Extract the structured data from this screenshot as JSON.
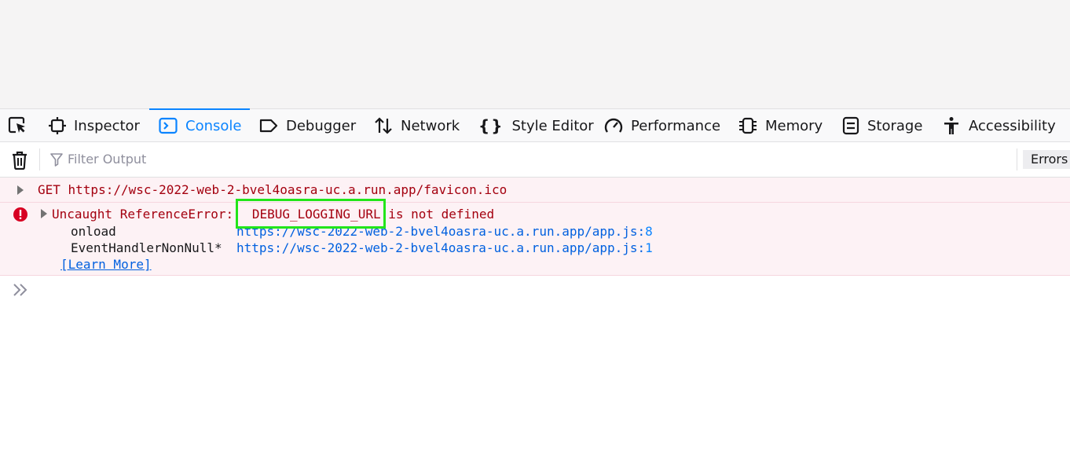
{
  "toolbar": {
    "tabs": [
      {
        "label": "Inspector",
        "icon": "inspector-icon"
      },
      {
        "label": "Console",
        "icon": "console-icon",
        "selected": true
      },
      {
        "label": "Debugger",
        "icon": "debugger-icon"
      },
      {
        "label": "Network",
        "icon": "network-icon"
      },
      {
        "label": "Style Editor",
        "icon": "style-editor-icon"
      },
      {
        "label": "Performance",
        "icon": "performance-icon"
      },
      {
        "label": "Memory",
        "icon": "memory-icon"
      },
      {
        "label": "Storage",
        "icon": "storage-icon"
      },
      {
        "label": "Accessibility",
        "icon": "accessibility-icon"
      }
    ]
  },
  "filterbar": {
    "placeholder": "Filter Output",
    "errors_label": "Errors"
  },
  "messages": {
    "get_request": {
      "text": "GET https://wsc-2022-web-2-bvel4oasra-uc.a.run.app/favicon.ico"
    },
    "error": {
      "prefix": "Uncaught ReferenceError: ",
      "name": "DEBUG_LOGGING_URL",
      "suffix": " is not defined",
      "stack": [
        {
          "fn": "onload",
          "url": "https://wsc-2022-web-2-bvel4oasra-uc.a.run.app/app.js:",
          "line": "8"
        },
        {
          "fn": "EventHandlerNonNull*",
          "url": "https://wsc-2022-web-2-bvel4oasra-uc.a.run.app/app.js:",
          "line": "1"
        }
      ],
      "learn_more": "[Learn More]"
    }
  },
  "colors": {
    "accent": "#0a84ff",
    "error_text": "#a4000f",
    "error_bg": "#fdf2f5",
    "link": "#0060df",
    "highlight": "#22e51a"
  }
}
